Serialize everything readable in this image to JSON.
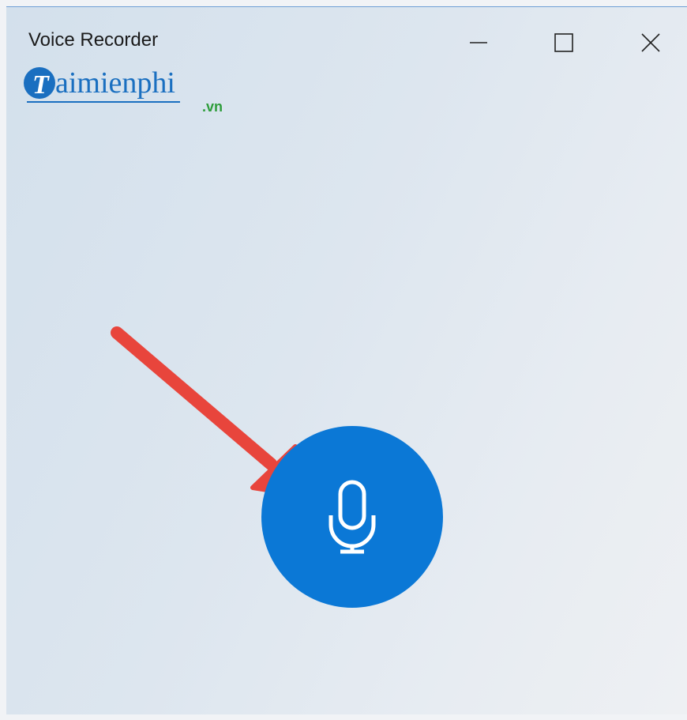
{
  "window": {
    "title": "Voice Recorder",
    "controls": {
      "minimize_icon": "minimize-icon",
      "maximize_icon": "maximize-icon",
      "close_icon": "close-icon"
    }
  },
  "watermark": {
    "logo_text": "aimienphi",
    "domain": ".vn",
    "letter": "T"
  },
  "main": {
    "record_button_icon": "microphone-icon",
    "accent_color": "#0b78d6",
    "annotation_color": "#e8453c"
  }
}
